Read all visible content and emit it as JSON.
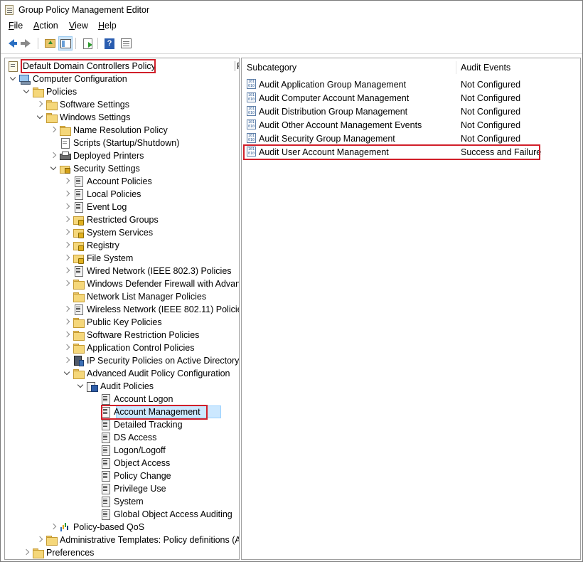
{
  "window": {
    "title": "Group Policy Management Editor"
  },
  "menu": [
    "File",
    "Action",
    "View",
    "Help"
  ],
  "toolbar": {
    "buttons": [
      "back-icon",
      "forward-icon",
      "up-folder-icon",
      "show-hide-tree-icon",
      "export-list-icon",
      "help-icon",
      "properties-icon"
    ]
  },
  "tree": {
    "root": "Default Domain Controllers Policy",
    "nodes": [
      {
        "label": "Computer Configuration",
        "icon": "computer-icon"
      },
      {
        "label": "Policies",
        "icon": "folder-icon"
      },
      {
        "label": "Software Settings",
        "icon": "folder-icon"
      },
      {
        "label": "Windows Settings",
        "icon": "folder-icon"
      },
      {
        "label": "Name Resolution Policy",
        "icon": "folder-icon"
      },
      {
        "label": "Scripts (Startup/Shutdown)",
        "icon": "script-icon"
      },
      {
        "label": "Deployed Printers",
        "icon": "printer-icon"
      },
      {
        "label": "Security Settings",
        "icon": "security-folder-icon"
      },
      {
        "label": "Account Policies",
        "icon": "policy-icon"
      },
      {
        "label": "Local Policies",
        "icon": "policy-icon"
      },
      {
        "label": "Event Log",
        "icon": "policy-icon"
      },
      {
        "label": "Restricted Groups",
        "icon": "lock-folder-icon"
      },
      {
        "label": "System Services",
        "icon": "lock-folder-icon"
      },
      {
        "label": "Registry",
        "icon": "lock-folder-icon"
      },
      {
        "label": "File System",
        "icon": "lock-folder-icon"
      },
      {
        "label": "Wired Network (IEEE 802.3) Policies",
        "icon": "network-policy-icon"
      },
      {
        "label": "Windows Defender Firewall with Advan",
        "icon": "folder-icon"
      },
      {
        "label": "Network List Manager Policies",
        "icon": "folder-icon"
      },
      {
        "label": "Wireless Network (IEEE 802.11) Policies",
        "icon": "network-policy-icon"
      },
      {
        "label": "Public Key Policies",
        "icon": "folder-icon"
      },
      {
        "label": "Software Restriction Policies",
        "icon": "folder-icon"
      },
      {
        "label": "Application Control Policies",
        "icon": "folder-icon"
      },
      {
        "label": "IP Security Policies on Active Directory",
        "icon": "ipsec-icon"
      },
      {
        "label": "Advanced Audit Policy Configuration",
        "icon": "folder-icon"
      },
      {
        "label": "Audit Policies",
        "icon": "audit-policies-icon"
      },
      {
        "label": "Account Logon",
        "icon": "policy-icon"
      },
      {
        "label": "Account Management",
        "icon": "policy-icon"
      },
      {
        "label": "Detailed Tracking",
        "icon": "policy-icon"
      },
      {
        "label": "DS Access",
        "icon": "policy-icon"
      },
      {
        "label": "Logon/Logoff",
        "icon": "policy-icon"
      },
      {
        "label": "Object Access",
        "icon": "policy-icon"
      },
      {
        "label": "Policy Change",
        "icon": "policy-icon"
      },
      {
        "label": "Privilege Use",
        "icon": "policy-icon"
      },
      {
        "label": "System",
        "icon": "policy-icon"
      },
      {
        "label": "Global Object Access Auditing",
        "icon": "policy-icon"
      },
      {
        "label": "Policy-based QoS",
        "icon": "qos-icon"
      },
      {
        "label": "Administrative Templates: Policy definitions (A",
        "icon": "folder-icon"
      },
      {
        "label": "Preferences",
        "icon": "folder-icon"
      }
    ],
    "header_cut": "P"
  },
  "list": {
    "columns": [
      "Subcategory",
      "Audit Events"
    ],
    "rows": [
      {
        "subcategory": "Audit Application Group Management",
        "events": "Not Configured"
      },
      {
        "subcategory": "Audit Computer Account Management",
        "events": "Not Configured"
      },
      {
        "subcategory": "Audit Distribution Group Management",
        "events": "Not Configured"
      },
      {
        "subcategory": "Audit Other Account Management Events",
        "events": "Not Configured"
      },
      {
        "subcategory": "Audit Security Group Management",
        "events": "Not Configured"
      },
      {
        "subcategory": "Audit User Account Management",
        "events": "Success and Failure"
      }
    ],
    "row_icon_text": "101 010"
  },
  "colors": {
    "highlight_border": "#d11f2a",
    "selection": "#cce8ff"
  }
}
